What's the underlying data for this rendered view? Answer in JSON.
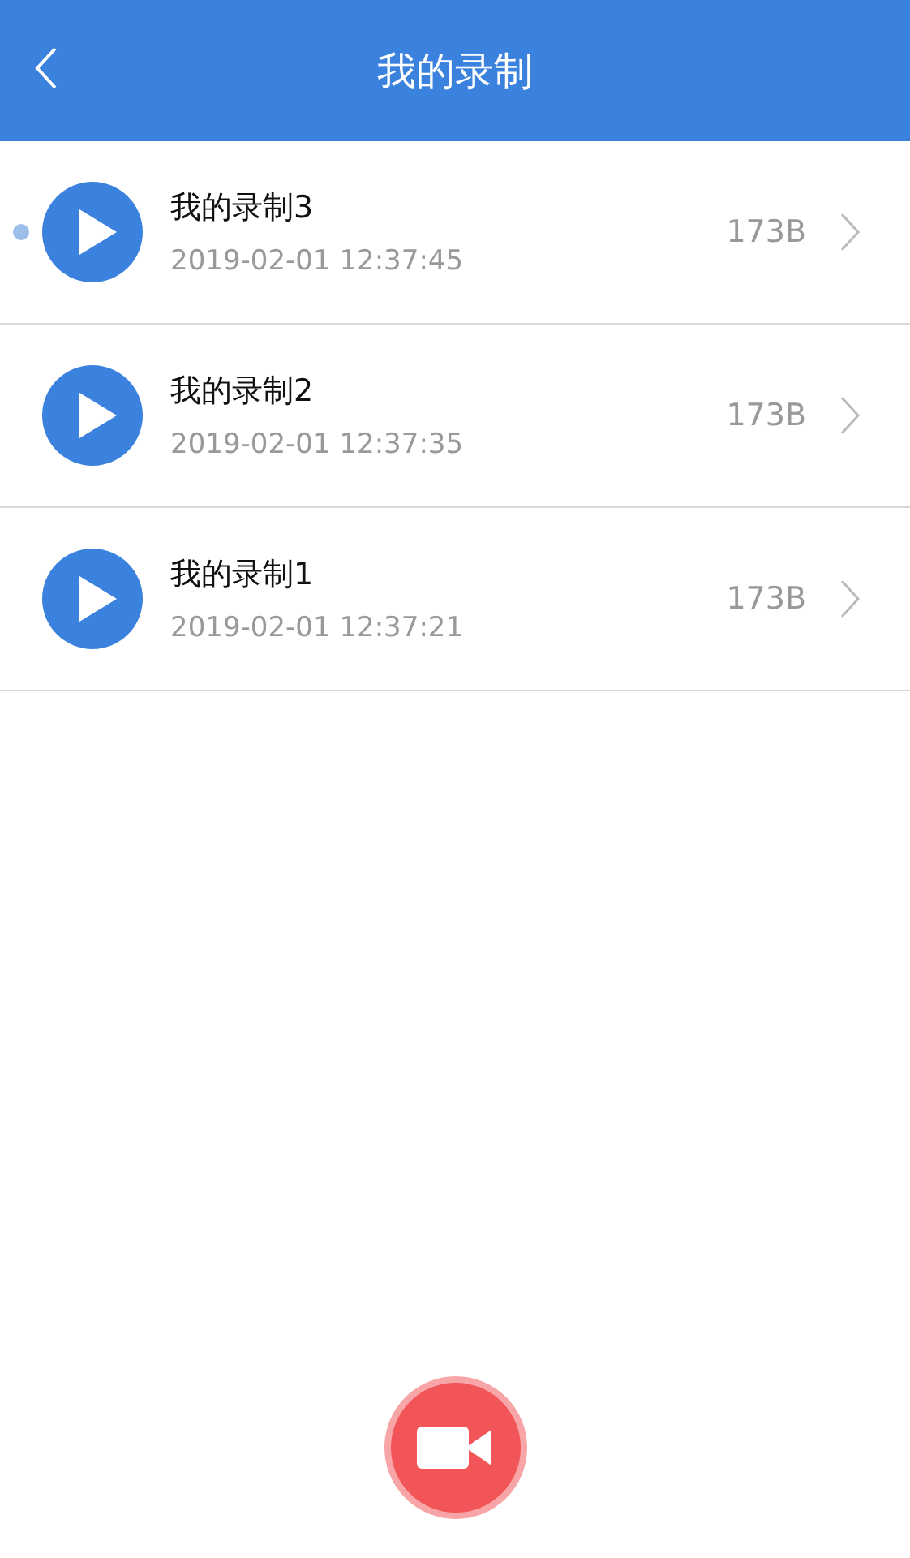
{
  "header": {
    "title": "我的录制"
  },
  "recordings": [
    {
      "name": "我的录制3",
      "time": "2019-02-01 12:37:45",
      "size": "173B",
      "new": true
    },
    {
      "name": "我的录制2",
      "time": "2019-02-01 12:37:35",
      "size": "173B",
      "new": false
    },
    {
      "name": "我的录制1",
      "time": "2019-02-01 12:37:21",
      "size": "173B",
      "new": false
    }
  ]
}
